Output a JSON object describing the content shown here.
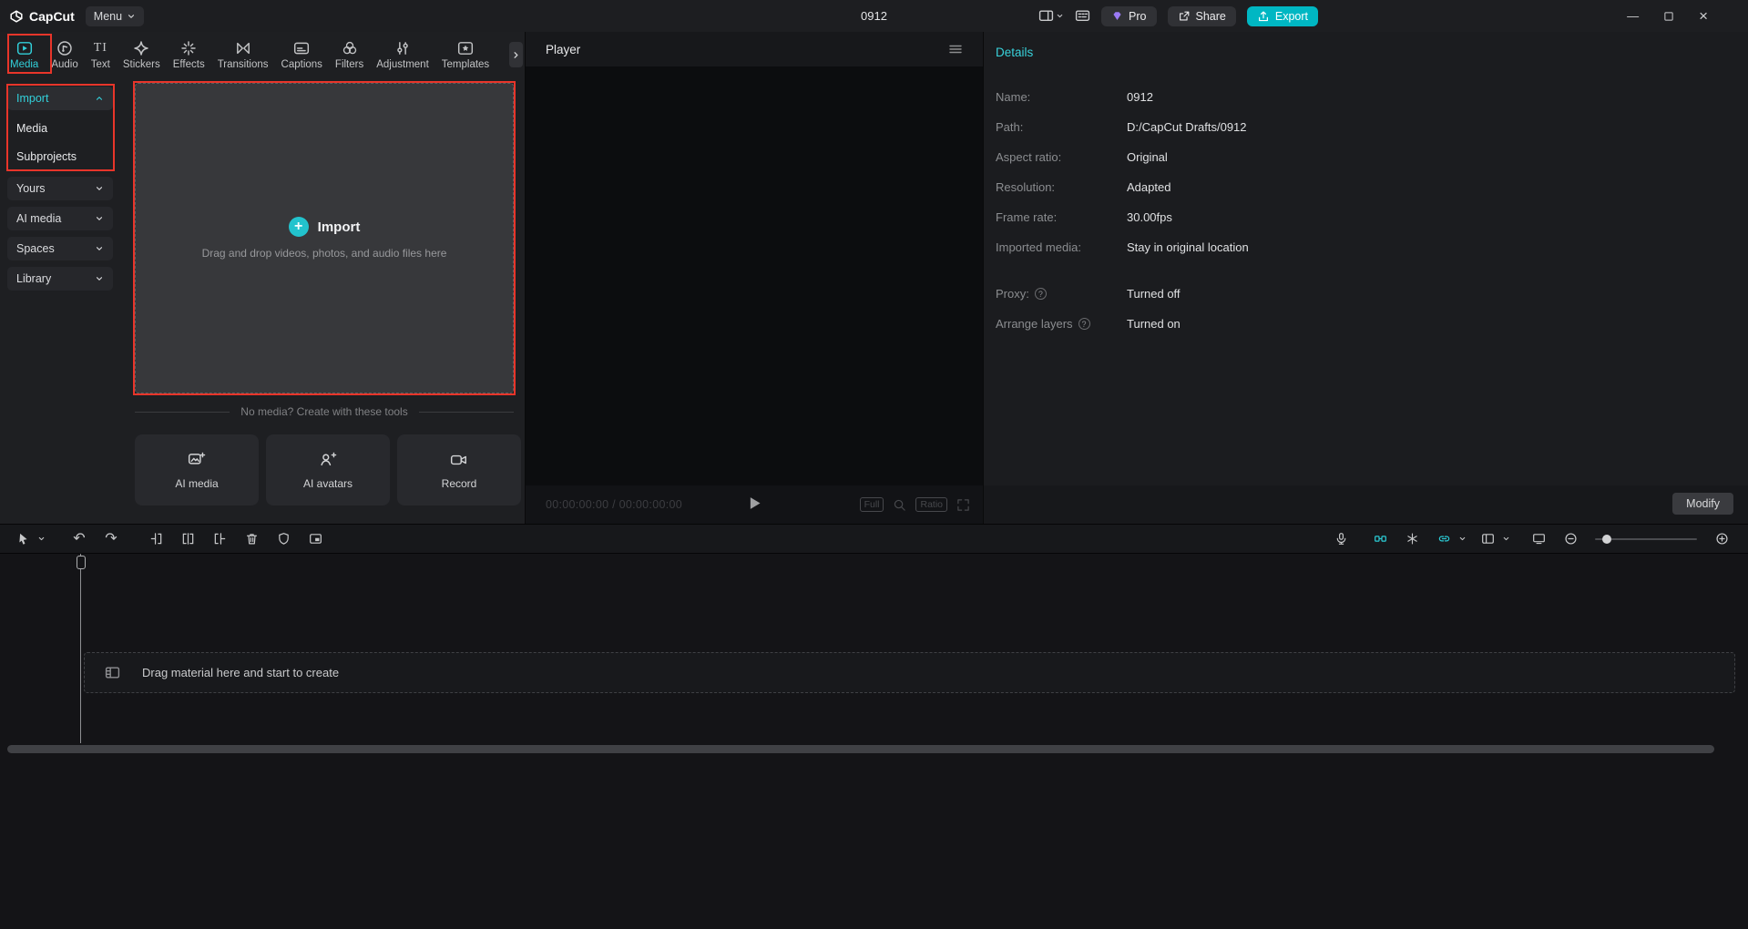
{
  "colors": {
    "accent": "#00c2cc",
    "annotation_red": "#e8352a",
    "pro_purple": "#9b7af5"
  },
  "titlebar": {
    "logo": "CapCut",
    "menu_label": "Menu",
    "project_title": "0912",
    "pro_label": "Pro",
    "share_label": "Share",
    "export_label": "Export"
  },
  "glyphs": {
    "undo": "↶",
    "redo": "↷",
    "plus": "+",
    "text_tab_icon": "TI",
    "info": "?",
    "minimize": "—",
    "close": "×"
  },
  "tabs": [
    {
      "label": "Media"
    },
    {
      "label": "Audio"
    },
    {
      "label": "Text"
    },
    {
      "label": "Stickers"
    },
    {
      "label": "Effects"
    },
    {
      "label": "Transitions"
    },
    {
      "label": "Captions"
    },
    {
      "label": "Filters"
    },
    {
      "label": "Adjustment"
    },
    {
      "label": "Templates"
    }
  ],
  "sidebar": {
    "import_label": "Import",
    "media_label": "Media",
    "subprojects_label": "Subprojects",
    "groups": [
      {
        "label": "Yours"
      },
      {
        "label": "AI media"
      },
      {
        "label": "Spaces"
      },
      {
        "label": "Library"
      }
    ]
  },
  "import_zone": {
    "title": "Import",
    "hint": "Drag and drop videos, photos, and audio files here"
  },
  "tools": {
    "header": "No media? Create with these tools",
    "cards": [
      {
        "label": "AI media"
      },
      {
        "label": "AI avatars"
      },
      {
        "label": "Record"
      }
    ]
  },
  "player": {
    "title": "Player",
    "timecode": "00:00:00:00 / 00:00:00:00",
    "full_label": "Full",
    "ratio_label": "Ratio"
  },
  "details": {
    "title": "Details",
    "rows": [
      {
        "label": "Name:",
        "value": "0912"
      },
      {
        "label": "Path:",
        "value": "D:/CapCut Drafts/0912"
      },
      {
        "label": "Aspect ratio:",
        "value": "Original"
      },
      {
        "label": "Resolution:",
        "value": "Adapted"
      },
      {
        "label": "Frame rate:",
        "value": "30.00fps"
      },
      {
        "label": "Imported media:",
        "value": "Stay in original location"
      }
    ],
    "toggles": [
      {
        "label": "Proxy:",
        "value": "Turned off"
      },
      {
        "label": "Arrange layers",
        "value": "Turned on"
      }
    ],
    "modify_label": "Modify"
  },
  "timeline": {
    "placeholder": "Drag material here and start to create"
  }
}
